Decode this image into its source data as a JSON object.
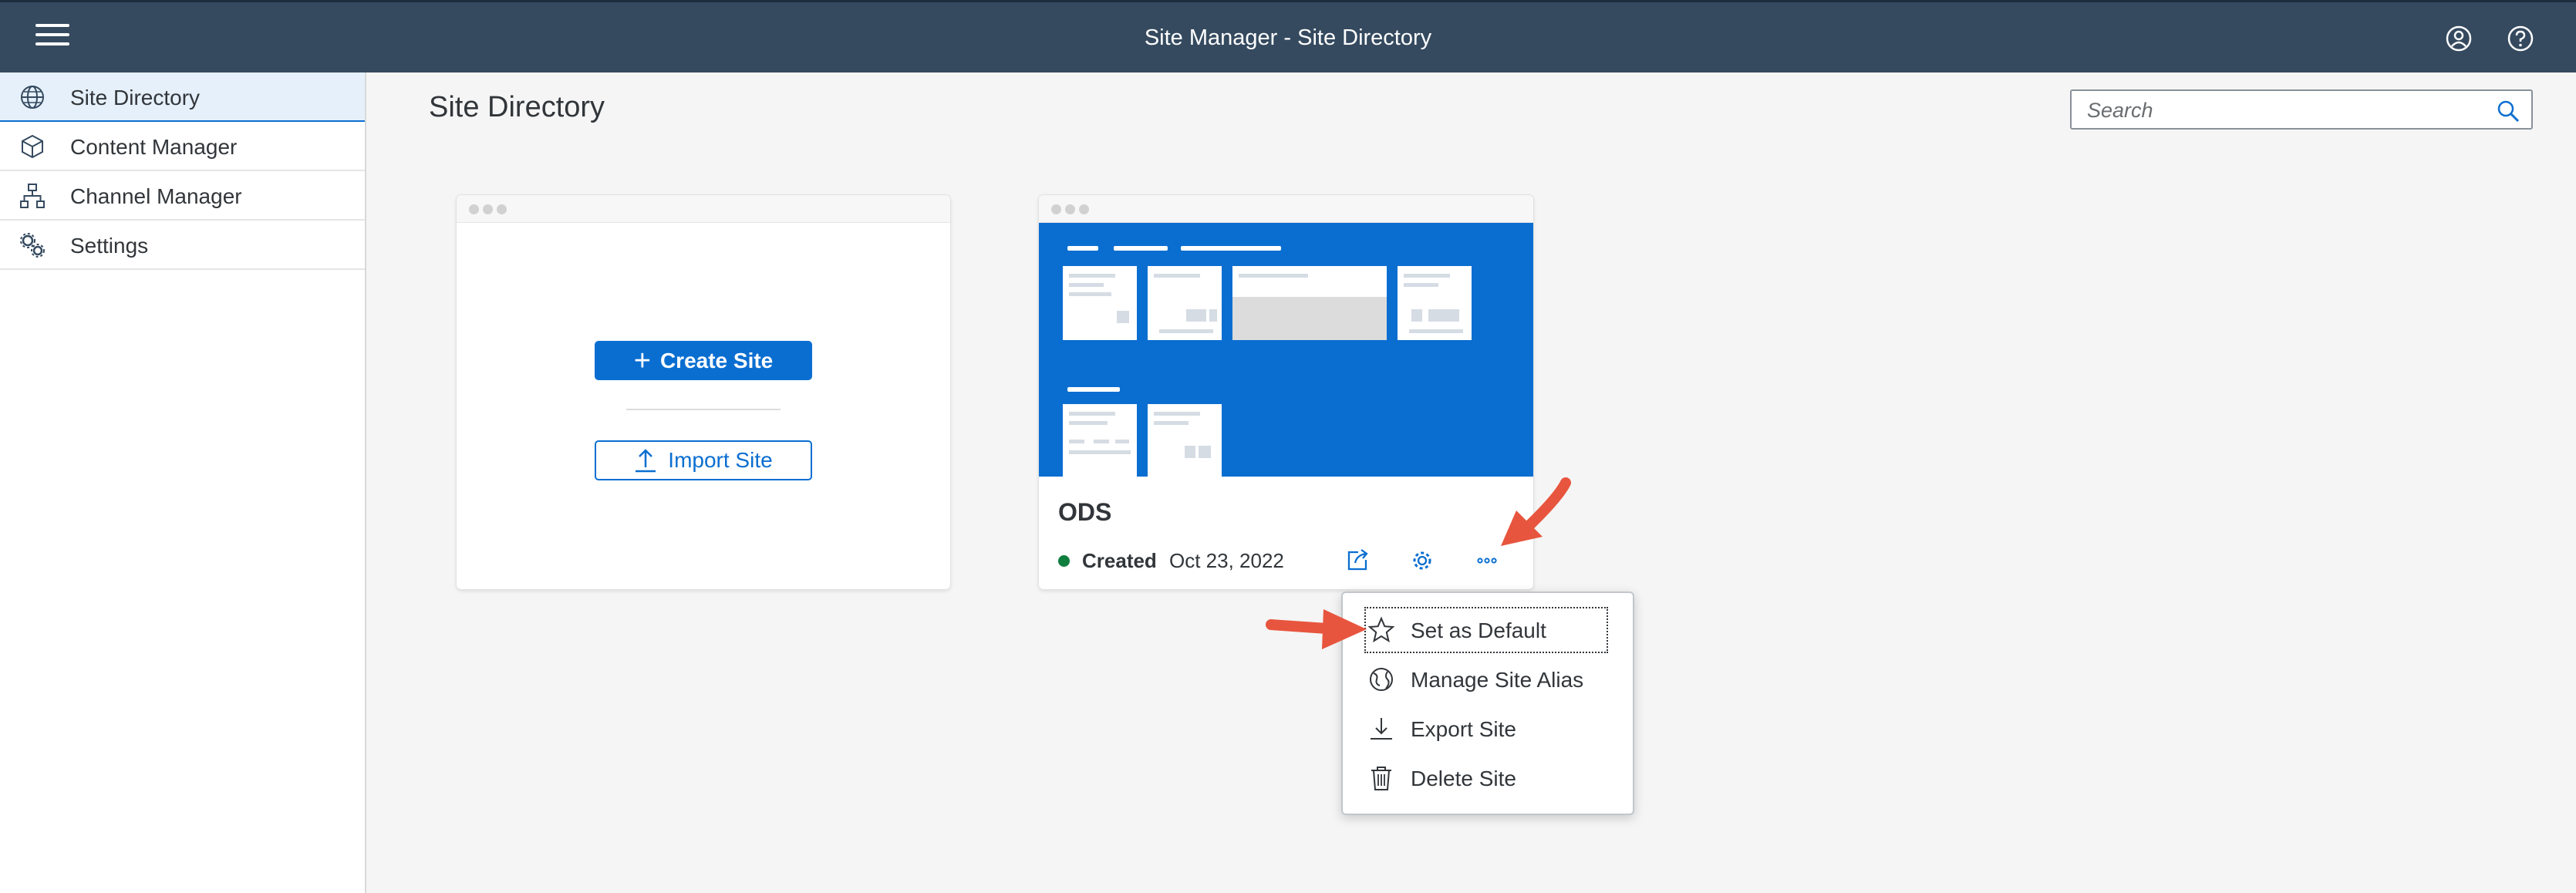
{
  "shell": {
    "title": "Site Manager - Site Directory"
  },
  "sidebar": {
    "items": [
      {
        "label": "Site Directory",
        "icon": "globe-icon",
        "selected": true
      },
      {
        "label": "Content Manager",
        "icon": "cube-icon",
        "selected": false
      },
      {
        "label": "Channel Manager",
        "icon": "hierarchy-icon",
        "selected": false
      },
      {
        "label": "Settings",
        "icon": "gears-icon",
        "selected": false
      }
    ]
  },
  "main": {
    "title": "Site Directory",
    "search": {
      "placeholder": "Search",
      "value": ""
    },
    "create_card": {
      "create_label": "Create Site",
      "import_label": "Import Site"
    },
    "site_card": {
      "name": "ODS",
      "status": "Created",
      "date": "Oct 23, 2022",
      "status_color": "#107e3e"
    }
  },
  "context_menu": {
    "items": [
      {
        "label": "Set as Default",
        "icon": "star-icon",
        "focused": true
      },
      {
        "label": "Manage Site Alias",
        "icon": "world-alias-icon",
        "focused": false
      },
      {
        "label": "Export Site",
        "icon": "download-icon",
        "focused": false
      },
      {
        "label": "Delete Site",
        "icon": "trash-icon",
        "focused": false
      }
    ]
  },
  "colors": {
    "shell": "#354a5f",
    "accent": "#0a6ed1",
    "annotation_arrow": "#e8553e"
  }
}
